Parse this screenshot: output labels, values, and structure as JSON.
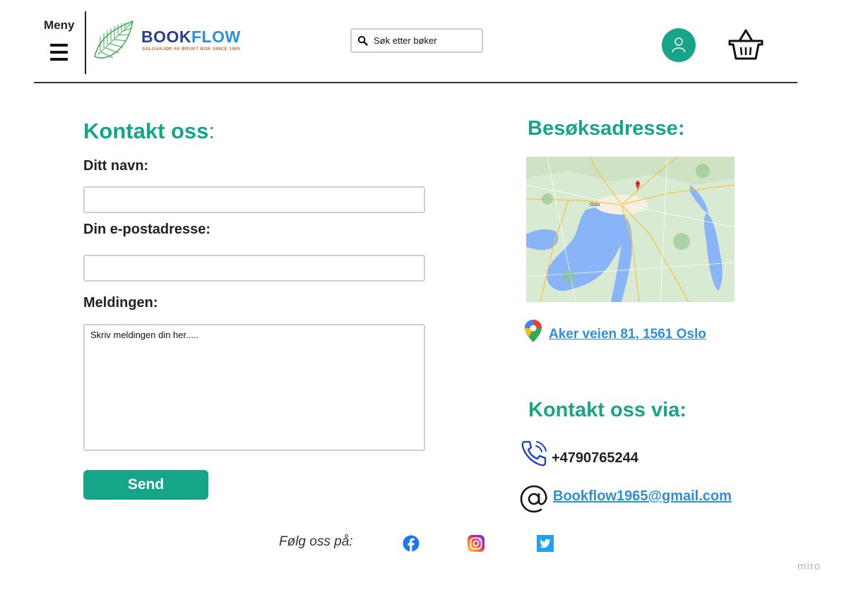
{
  "header": {
    "menu_label": "Meny",
    "brand": {
      "name_part1": "BOOK",
      "name_part2": "FLOW",
      "tagline": "SALGAKJØP AV BRUKT BOK SINCE 1965"
    },
    "search_placeholder": "Søk etter bøker",
    "icons": {
      "menu": "hamburger-icon",
      "search": "search-icon",
      "user": "user-icon",
      "cart": "basket-icon"
    }
  },
  "form": {
    "title": "Kontakt oss",
    "title_colon": ":",
    "name_label": "Ditt navn:",
    "email_label": "Din e-postadresse:",
    "message_label": "Meldingen:",
    "message_placeholder": "Skriv meldingen din her.....",
    "send_label": "Send"
  },
  "address": {
    "title": "Besøksadresse:",
    "map_label": "Oslo",
    "street": "Aker veien 81, 1561 Oslo",
    "icon": "google-maps-pin-icon"
  },
  "contact": {
    "title": "Kontakt oss via:",
    "phone": "+4790765244",
    "email": " Bookflow1965@gmail.com",
    "icons": {
      "phone": "phone-icon",
      "email": "at-sign-icon"
    }
  },
  "footer": {
    "follow_label": "Følg oss på:",
    "social": [
      "facebook-icon",
      "instagram-icon",
      "twitter-icon"
    ],
    "watermark": "miro"
  },
  "colors": {
    "accent": "#17a589",
    "link": "#2f8fd6",
    "brand_dark": "#2b3f8f"
  }
}
